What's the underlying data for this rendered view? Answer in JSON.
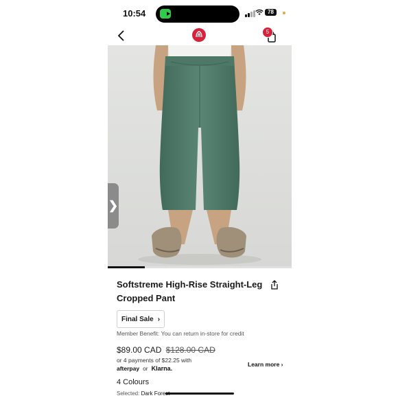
{
  "status_bar": {
    "time": "10:54",
    "battery": "78"
  },
  "cart": {
    "count": "5"
  },
  "product": {
    "title": "Softstreme High-Rise Straight-Leg Cropped Pant",
    "final_sale_label": "Final Sale",
    "member_benefit": "Member Benefit: You can return in-store for credit",
    "price": "$89.00 CAD",
    "original_price": "$128.00 CAD",
    "installments": "or 4 payments of $22.25 with",
    "afterpay": "afterpay",
    "or": "or",
    "klarna": "Klarna.",
    "learn_more": "Learn more",
    "colours": "4 Colours",
    "selected_label": "Selected:",
    "selected_colour": "Dark Forest"
  },
  "gallery": {
    "progress": 0.2
  },
  "icons": {
    "back": "chevron-left-icon",
    "logo": "lululemon-logo",
    "cart": "shopping-bag-icon",
    "share": "share-icon",
    "next": "chevron-right-icon"
  },
  "colors": {
    "accent": "#d6233c",
    "pant": "#4e7a68"
  }
}
